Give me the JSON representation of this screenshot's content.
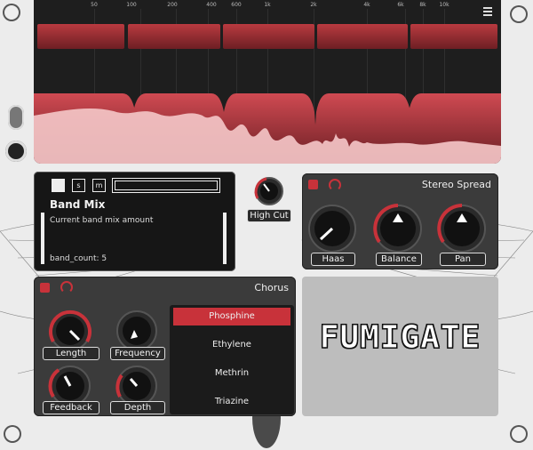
{
  "spectrum": {
    "freq_labels": [
      "50",
      "100",
      "200",
      "400",
      "600",
      "1k",
      "2k",
      "4k",
      "6k",
      "8k",
      "10k"
    ],
    "menu_icon": "hamburger-icon"
  },
  "band_mix": {
    "buttons": [
      "",
      "s",
      "m"
    ],
    "title": "Band Mix",
    "description": "Current band mix amount",
    "band_count": "band_count: 5"
  },
  "high_cut": {
    "label": "High Cut"
  },
  "stereo_spread": {
    "title": "Stereo Spread",
    "knobs": [
      "Haas",
      "Balance",
      "Pan"
    ]
  },
  "chorus": {
    "title": "Chorus",
    "knobs": [
      "Length",
      "Frequency",
      "Feedback",
      "Depth"
    ],
    "presets": [
      "Phosphine",
      "Ethylene",
      "Methrin",
      "Triazine"
    ],
    "selected_preset": "Phosphine"
  },
  "logo": {
    "text": "FUMIGATE"
  },
  "colors": {
    "accent": "#c8323a",
    "panel": "#3b3b3b",
    "dark": "#1e1e1e"
  }
}
